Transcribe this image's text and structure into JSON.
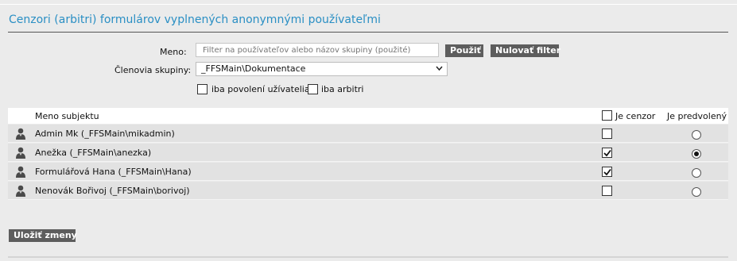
{
  "page": {
    "title": "Cenzori (arbitri) formulárov vyplnených anonymnými používateľmi"
  },
  "filter": {
    "name_label": "Meno:",
    "name_placeholder": "Filter na používateľov alebo názov skupiny (použité)",
    "name_value": "",
    "apply_button": "Použiť",
    "reset_button": "Nulovať filter",
    "group_label": "Členovia skupiny:",
    "group_selected": "_FFSMain\\Dokumentace",
    "only_allowed_users": {
      "label": "iba povolení užívatelia",
      "checked": false
    },
    "only_arbiters": {
      "label": "iba arbitri",
      "checked": false
    }
  },
  "table": {
    "columns": {
      "subject": "Meno subjektu",
      "is_censor": "Je cenzor",
      "is_default": "Je predvolený"
    },
    "header_censor_checked": false,
    "rows": [
      {
        "name": "Admin Mk (_FFSMain\\mikadmin)",
        "is_censor": false,
        "is_default": false,
        "icon": "user-icon"
      },
      {
        "name": "Anežka (_FFSMain\\anezka)",
        "is_censor": true,
        "is_default": true,
        "icon": "user-icon"
      },
      {
        "name": "Formulářová Hana (_FFSMain\\Hana)",
        "is_censor": true,
        "is_default": false,
        "icon": "user-icon"
      },
      {
        "name": "Nenovák Bořivoj (_FFSMain\\borivoj)",
        "is_censor": false,
        "is_default": false,
        "icon": "user-icon"
      }
    ]
  },
  "actions": {
    "save_button": "Uložiť zmeny"
  },
  "colors": {
    "title": "#2a8fc4",
    "button_bg": "#5d5d5d",
    "page_bg": "#ebebeb",
    "row_bg": "#e2e2e2"
  }
}
